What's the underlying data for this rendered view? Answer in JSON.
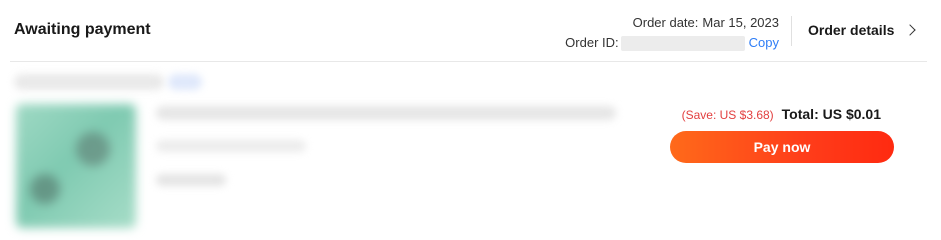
{
  "order": {
    "status": "Awaiting payment",
    "date_label": "Order date:",
    "date_value": "Mar 15, 2023",
    "id_label": "Order ID:",
    "copy_label": "Copy",
    "details_label": "Order details"
  },
  "payment": {
    "save_text": "(Save: US $3.68)",
    "total_text": "Total: US $0.01",
    "pay_label": "Pay now"
  },
  "icons": {
    "details_chevron": "chevron-right-icon"
  },
  "colors": {
    "accent": "#ff4d1a",
    "link": "#2e7df6",
    "save": "#e23f3f"
  }
}
